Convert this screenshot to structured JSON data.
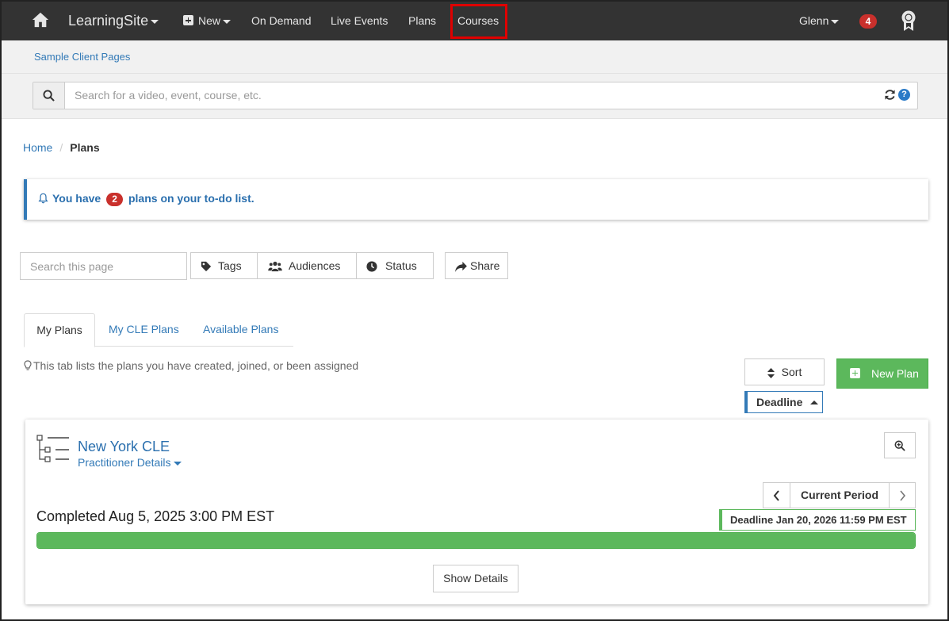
{
  "topnav": {
    "brand": "LearningSite",
    "new_label": "New",
    "links": [
      "On Demand",
      "Live Events",
      "Plans",
      "Courses"
    ],
    "user": "Glenn",
    "notifications": "4"
  },
  "subnav": {
    "link": "Sample Client Pages"
  },
  "search": {
    "placeholder": "Search for a video, event, course, etc."
  },
  "breadcrumb": {
    "home": "Home",
    "separator": "/",
    "current": "Plans"
  },
  "alert": {
    "prefix": "You have",
    "count": "2",
    "suffix": "plans on your to-do list."
  },
  "filters": {
    "search_placeholder": "Search this page",
    "tags": "Tags",
    "audiences": "Audiences",
    "status": "Status",
    "share": "Share"
  },
  "tabs": [
    {
      "label": "My Plans",
      "active": true
    },
    {
      "label": "My CLE Plans",
      "active": false
    },
    {
      "label": "Available Plans",
      "active": false
    }
  ],
  "hint": "This tab lists the plans you have created, joined, or been assigned",
  "toolbar": {
    "sort": "Sort",
    "new_plan": "New Plan",
    "sort_field": "Deadline"
  },
  "plan": {
    "title": "New York CLE",
    "subtitle": "Practitioner Details",
    "period": "Current Period",
    "completed": "Completed Aug 5, 2025 3:00 PM EST",
    "deadline": "Deadline Jan 20, 2026 11:59 PM EST",
    "progress_percent": 100,
    "show_details": "Show Details"
  },
  "colors": {
    "nav_bg": "#333333",
    "accent": "#337ab7",
    "success": "#5cb85c",
    "danger": "#c9302c",
    "highlight": "#e00000"
  }
}
